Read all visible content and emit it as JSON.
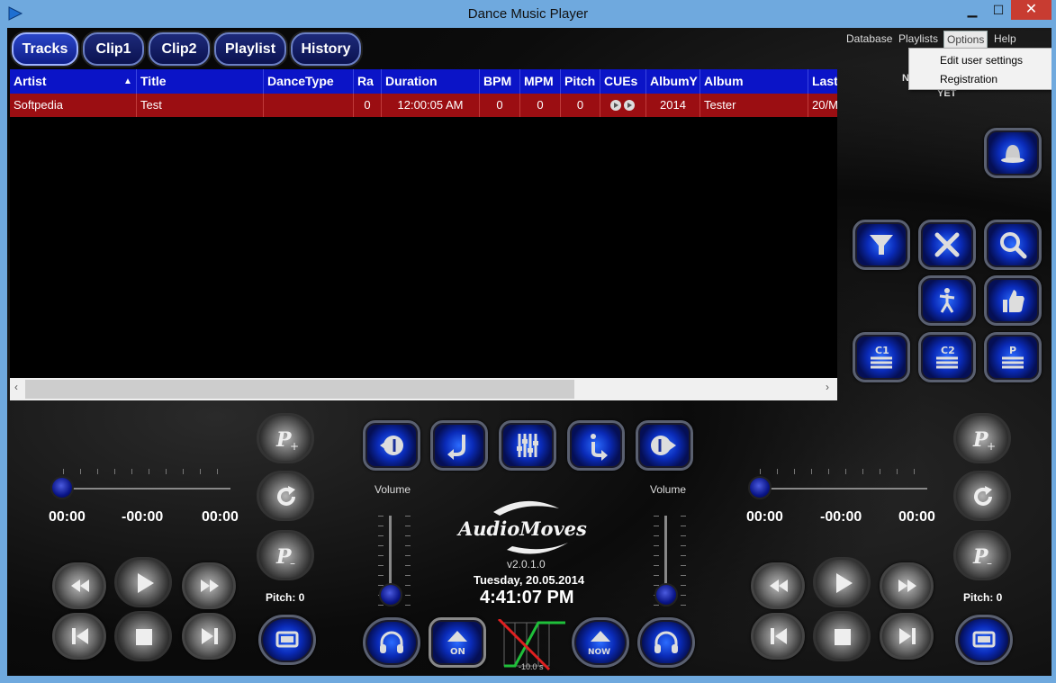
{
  "window": {
    "title": "Dance Music Player",
    "minimize": "▁",
    "maximize": "☐",
    "close": "✕"
  },
  "tabs": [
    {
      "label": "Tracks"
    },
    {
      "label": "Clip1"
    },
    {
      "label": "Clip2"
    },
    {
      "label": "Playlist"
    },
    {
      "label": "History"
    }
  ],
  "menu": {
    "database": "Database",
    "playlists": "Playlists",
    "options": "Options",
    "help": "Help"
  },
  "dropdown": {
    "items": [
      "Edit user settings",
      "Registration"
    ]
  },
  "now_label": "N",
  "yet_label": "YET",
  "table": {
    "columns": [
      "Artist",
      "Title",
      "DanceType",
      "Ra",
      "Duration",
      "BPM",
      "MPM",
      "Pitch",
      "CUEs",
      "AlbumY",
      "Album",
      "Last"
    ],
    "sort_indicator": "▲",
    "rows": [
      [
        "Softpedia",
        "Test",
        "",
        "0",
        "12:00:05 AM",
        "0",
        "0",
        "0",
        "",
        "2014",
        "Tester",
        "20/M"
      ]
    ]
  },
  "scroll": {
    "left": "‹",
    "right": "›"
  },
  "left_deck": {
    "elapsed": "00:00",
    "remaining": "-00:00",
    "total": "00:00",
    "pitch": "Pitch: 0"
  },
  "right_deck": {
    "elapsed": "00:00",
    "remaining": "-00:00",
    "total": "00:00",
    "pitch": "Pitch: 0"
  },
  "volume_label_left": "Volume",
  "volume_label_right": "Volume",
  "logo_text": "AudioMoves",
  "version": "v2.0.1.0",
  "date": "Tuesday, 20.05.2014",
  "clock": "4:41:07 PM",
  "fade_label": "-10.0 s",
  "colors": {
    "header": "#0b14c7",
    "row": "#9b0e12",
    "accent": "#2c6cff"
  }
}
